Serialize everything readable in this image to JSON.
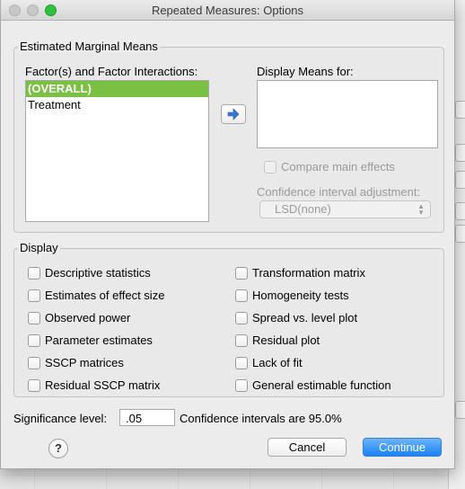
{
  "window": {
    "title": "Repeated Measures: Options"
  },
  "emm": {
    "legend": "Estimated Marginal Means",
    "factors_label": "Factor(s) and Factor Interactions:",
    "factors": [
      {
        "label": "(OVERALL)",
        "selected": true
      },
      {
        "label": "Treatment",
        "selected": false
      }
    ],
    "display_means_label": "Display Means for:",
    "compare_main_effects": "Compare main effects",
    "ci_adjustment_label": "Confidence interval adjustment:",
    "ci_adjustment_value": "LSD(none)"
  },
  "display": {
    "legend": "Display",
    "left_options": [
      "Descriptive statistics",
      "Estimates of effect size",
      "Observed power",
      "Parameter estimates",
      "SSCP matrices",
      "Residual SSCP matrix"
    ],
    "right_options": [
      "Transformation matrix",
      "Homogeneity tests",
      "Spread vs. level plot",
      "Residual plot",
      "Lack of fit",
      "General estimable function"
    ]
  },
  "significance": {
    "label": "Significance level:",
    "value": ".05",
    "ci_text": "Confidence intervals are 95.0%"
  },
  "buttons": {
    "help": "?",
    "cancel": "Cancel",
    "continue": "Continue"
  },
  "colors": {
    "selection": "#7ac143",
    "primary_button": "#1a82f7",
    "close_green": "#2ec23e"
  }
}
